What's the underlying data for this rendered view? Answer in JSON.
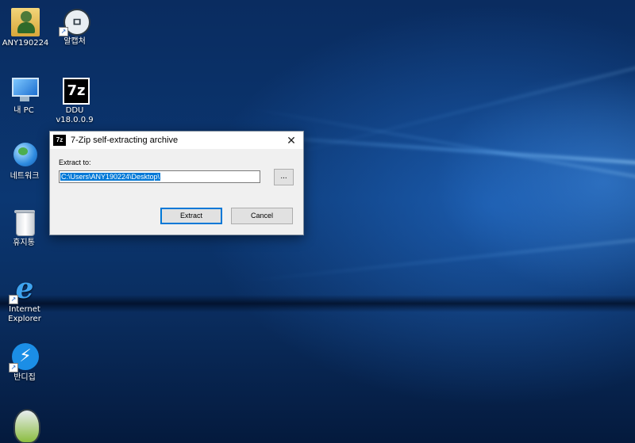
{
  "desktop": {
    "icons": [
      {
        "label": "ANY190224",
        "icon": "user-folder-icon",
        "shortcut": false
      },
      {
        "label": "알캡처",
        "icon": "alcapture-icon",
        "shortcut": true
      },
      {
        "label": "내 PC",
        "icon": "computer-icon",
        "shortcut": false
      },
      {
        "label": "DDU\nv18.0.0.9",
        "icon": "7zip-archive-icon",
        "shortcut": false
      },
      {
        "label": "네트워크",
        "icon": "network-globe-icon",
        "shortcut": false
      },
      {
        "label": "휴지통",
        "icon": "recycle-bin-icon",
        "shortcut": false
      },
      {
        "label": "Internet\nExplorer",
        "icon": "internet-explorer-icon",
        "shortcut": true
      },
      {
        "label": "반디집",
        "icon": "bandizip-icon",
        "shortcut": true
      },
      {
        "label": "",
        "icon": "mascot-app-icon",
        "shortcut": false
      }
    ]
  },
  "dialog": {
    "title": "7-Zip self-extracting archive",
    "title_icon": "7z",
    "close_glyph": "✕",
    "extract_label": "Extract to:",
    "path_value": "C:\\Users\\ANY190224\\Desktop\\",
    "browse_label": "...",
    "extract_button": "Extract",
    "cancel_button": "Cancel"
  },
  "colors": {
    "selection": "#0078d7",
    "dialog_bg": "#f0f0f0",
    "desktop_bg": "#0b3772"
  }
}
